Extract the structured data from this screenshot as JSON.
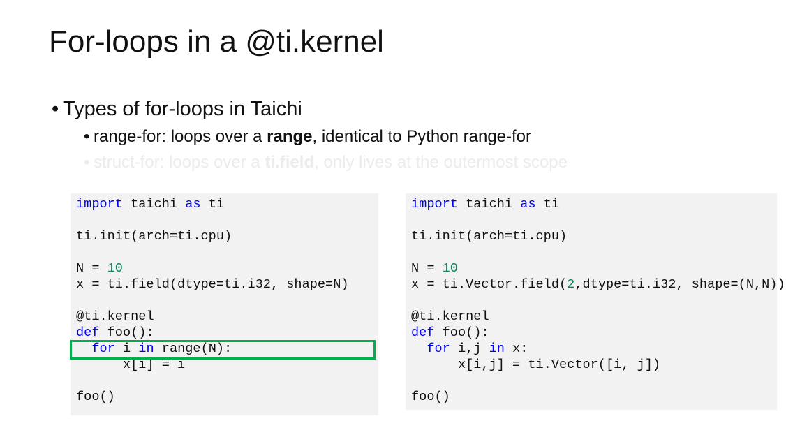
{
  "slide": {
    "title": "For-loops in a @ti.kernel",
    "bullet_1": "Types of for-loops in Taichi",
    "bullet_2": {
      "prefix": "range-for: loops over a ",
      "emphasis": "range",
      "suffix": ", identical to Python range-for"
    },
    "bullet_3": {
      "prefix": "struct-for: loops over a ",
      "emphasis": "ti.field",
      "suffix": ", only lives at the outermost scope"
    },
    "bullet_glyph": "•"
  },
  "code_left": {
    "l1": {
      "kw1": "import",
      "t1": " taichi ",
      "kw2": "as",
      "t2": " ti"
    },
    "l2": "ti.init(arch=ti.cpu)",
    "l3": {
      "t1": "N = ",
      "num": "10"
    },
    "l4": "x = ti.field(dtype=ti.i32, shape=N)",
    "l5": "@ti.kernel",
    "l6": {
      "kw": "def",
      "t": " foo():"
    },
    "l7": {
      "indent": "  ",
      "kw1": "for",
      "t1": " i ",
      "kw2": "in",
      "t2": " range(N):"
    },
    "l8": "      x[i] = i",
    "l9": "foo()"
  },
  "code_right": {
    "l1": {
      "kw1": "import",
      "t1": " taichi ",
      "kw2": "as",
      "t2": " ti"
    },
    "l2": "ti.init(arch=ti.cpu)",
    "l3": {
      "t1": "N = ",
      "num": "10"
    },
    "l4": {
      "t1": "x = ti.Vector.field(",
      "num": "2",
      "t2": ",dtype=ti.i32, shape=(N,N))"
    },
    "l5": "@ti.kernel",
    "l6": {
      "kw": "def",
      "t": " foo():"
    },
    "l7": {
      "indent": "  ",
      "kw1": "for",
      "t1": " i,j ",
      "kw2": "in",
      "t2": " x:"
    },
    "l8": "      x[i,j] = ti.Vector([i, j])",
    "l9": "foo()"
  },
  "colors": {
    "keyword": "#0000ff",
    "number": "#098658",
    "highlight_border": "#00b050",
    "faded_text": "#ececec",
    "code_background": "#f2f2f2"
  }
}
